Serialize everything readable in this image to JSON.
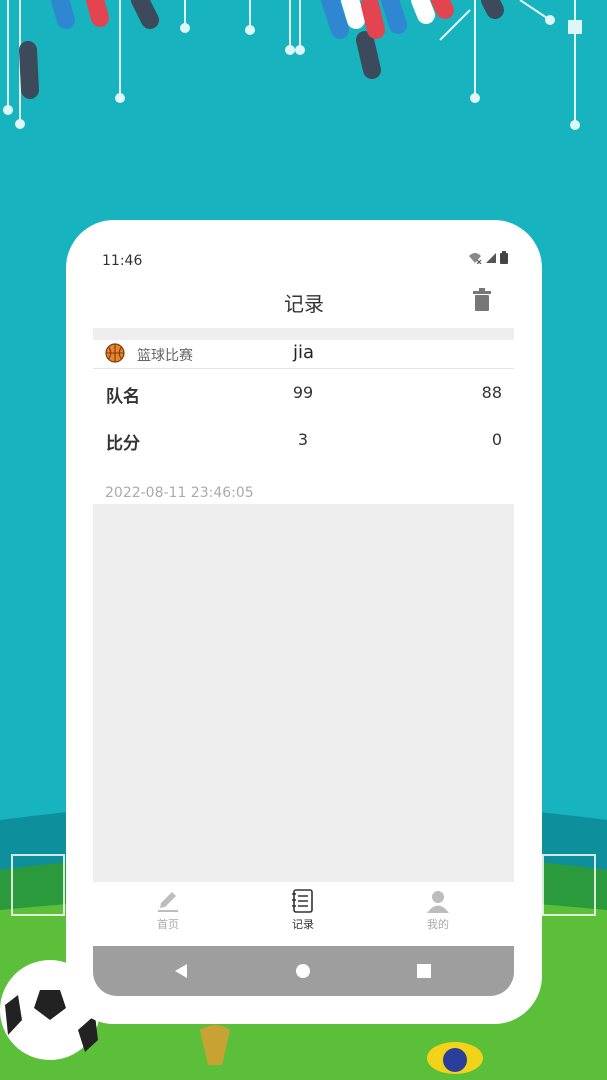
{
  "status_bar": {
    "time": "11:46"
  },
  "header": {
    "title": "记录"
  },
  "record": {
    "sport": "篮球比赛",
    "name": "jia",
    "rows": [
      {
        "label": "队名",
        "left": "99",
        "right": "88"
      },
      {
        "label": "比分",
        "left": "3",
        "right": "0"
      }
    ],
    "timestamp": "2022-08-11 23:46:05"
  },
  "tabs": [
    {
      "label": "首页",
      "icon": "edit-icon",
      "active": false
    },
    {
      "label": "记录",
      "icon": "notebook-icon",
      "active": true
    },
    {
      "label": "我的",
      "icon": "person-icon",
      "active": false
    }
  ],
  "colors": {
    "background": "#17b3bf",
    "card": "#ffffff",
    "content_bg": "#eeeeee",
    "nav_bar": "#9e9e9e",
    "basketball": "#e8842a"
  }
}
